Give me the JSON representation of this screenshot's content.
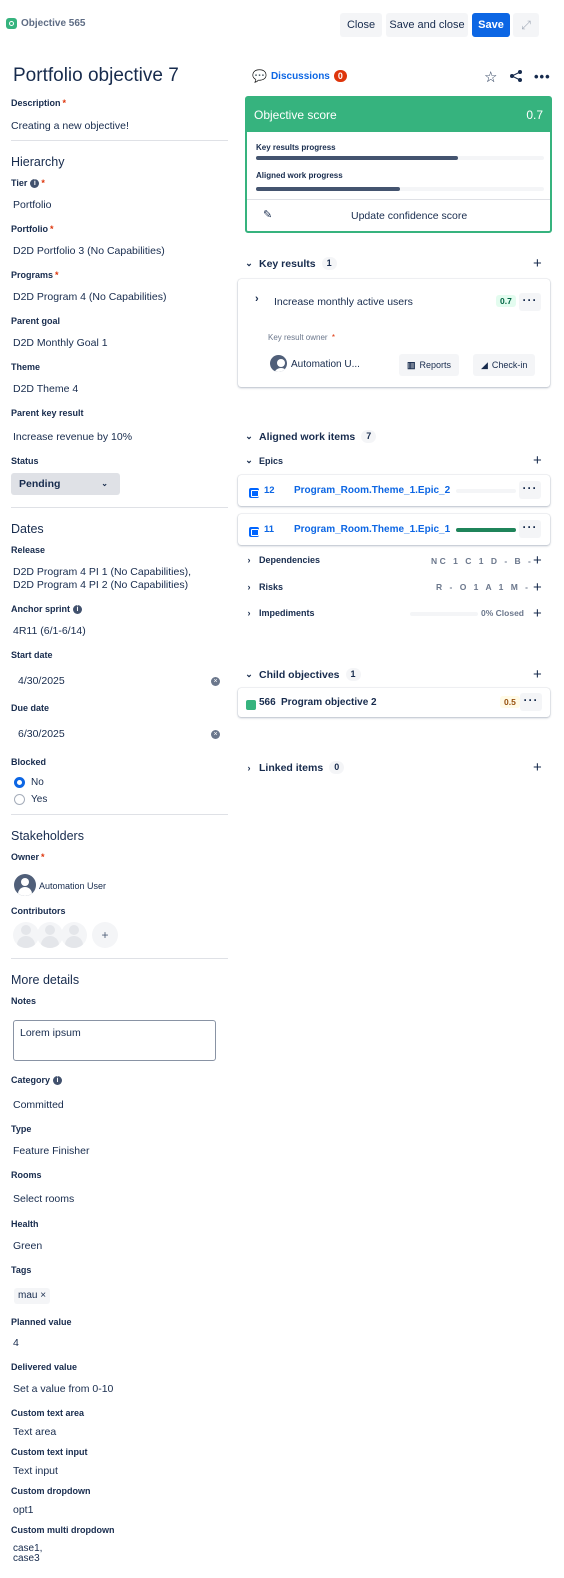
{
  "header": {
    "breadcrumb": "Objective 565",
    "close_label": "Close",
    "save_close_label": "Save and close",
    "save_label": "Save",
    "expand_icon": "expand-icon"
  },
  "title": "Portfolio objective 7",
  "description": {
    "label": "Description",
    "value": "Creating a new objective!"
  },
  "hierarchy": {
    "heading": "Hierarchy",
    "tier_label": "Tier",
    "tier_value": "Portfolio",
    "portfolio_label": "Portfolio",
    "portfolio_value": "D2D Portfolio 3 (No Capabilities)",
    "programs_label": "Programs",
    "programs_value": "D2D Program 4 (No Capabilities)",
    "parent_goal_label": "Parent goal",
    "parent_goal_value": "D2D Monthly Goal 1",
    "theme_label": "Theme",
    "theme_value": "D2D Theme 4",
    "parent_kr_label": "Parent key result",
    "parent_kr_value": "Increase revenue by 10%",
    "status_label": "Status",
    "status_value": "Pending"
  },
  "dates": {
    "heading": "Dates",
    "release_label": "Release",
    "release_line1": "D2D Program 4 PI 1 (No Capabilities),",
    "release_line2": "D2D Program 4 PI 2 (No Capabilities)",
    "anchor_label": "Anchor sprint",
    "anchor_value": "4R11 (6/1-6/14)",
    "start_label": "Start date",
    "start_value": "4/30/2025",
    "due_label": "Due date",
    "due_value": "6/30/2025",
    "blocked_label": "Blocked",
    "blocked_no": "No",
    "blocked_yes": "Yes"
  },
  "stakeholders": {
    "heading": "Stakeholders",
    "owner_label": "Owner",
    "owner_name": "Automation User",
    "contributors_label": "Contributors"
  },
  "more": {
    "heading": "More details",
    "notes_label": "Notes",
    "notes_value": "Lorem ipsum",
    "category_label": "Category",
    "category_value": "Committed",
    "type_label": "Type",
    "type_value": "Feature Finisher",
    "rooms_label": "Rooms",
    "rooms_value": "Select rooms",
    "health_label": "Health",
    "health_value": "Green",
    "tags_label": "Tags",
    "tag_value": "mau ×",
    "planned_label": "Planned value",
    "planned_value": "4",
    "delivered_label": "Delivered value",
    "delivered_value": "Set a value from 0-10",
    "cta_label": "Custom text area",
    "cta_value": "Text area",
    "cti_label": "Custom text input",
    "cti_value": "Text input",
    "cdd_label": "Custom dropdown",
    "cdd_value": "opt1",
    "cmd_label": "Custom multi dropdown",
    "cmd_value1": "case1,",
    "cmd_value2": "case3"
  },
  "right": {
    "discussions_label": "Discussions",
    "discussions_count": "0",
    "score": {
      "title": "Objective score",
      "value": "0.7",
      "kr_progress_label": "Key results progress",
      "kr_progress": 0.7,
      "aw_progress_label": "Aligned work progress",
      "aw_progress": 0.5,
      "update_label": "Update confidence score"
    },
    "key_results": {
      "heading": "Key results",
      "count": "1",
      "item_title": "Increase monthly active users",
      "item_score": "0.7",
      "owner_label": "Key result owner",
      "owner_name": "Automation U...",
      "reports_label": "Reports",
      "checkin_label": "Check-in"
    },
    "aligned": {
      "heading": "Aligned work items",
      "count": "7",
      "epics_label": "Epics",
      "epics": [
        {
          "num": "12",
          "title": "Program_Room.Theme_1.Epic_2",
          "progress": 0.0
        },
        {
          "num": "11",
          "title": "Program_Room.Theme_1.Epic_1",
          "progress": 1.0
        }
      ],
      "dependencies_label": "Dependencies",
      "dependencies_code": "NC 1 C 1 D - B -",
      "risks_label": "Risks",
      "risks_code": "R - O 1 A 1 M -",
      "impediments_label": "Impediments",
      "impediments_status": "0% Closed"
    },
    "child": {
      "heading": "Child objectives",
      "count": "1",
      "item_id": "566",
      "item_title": "Program objective 2",
      "item_score": "0.5"
    },
    "linked": {
      "heading": "Linked items",
      "count": "0"
    }
  },
  "colors": {
    "accent": "#0c66e4",
    "success": "#36b37e",
    "danger": "#de350b",
    "warning": "#ff991f"
  }
}
